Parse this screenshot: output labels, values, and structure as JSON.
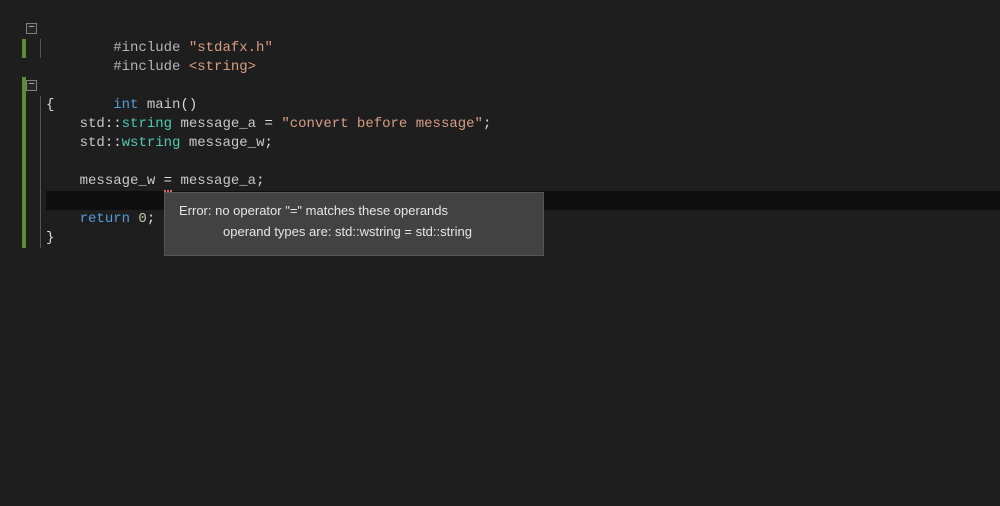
{
  "code": {
    "include_kw": "#include",
    "header1": "\"stdafx.h\"",
    "header2": "<string>",
    "int_kw": "int",
    "main_ident": "main",
    "parens": "()",
    "brace_open": "{",
    "brace_close": "}",
    "std_ns": "std",
    "scope_op": "::",
    "string_t": "string",
    "wstring_t": "wstring",
    "msg_a": "message_a",
    "msg_w": "message_w",
    "eq": " = ",
    "assign_eq": " = ",
    "literal": "\"convert before message\"",
    "semi": ";",
    "return_kw": "return",
    "zero": " 0",
    "indent1": "    ",
    "fold_glyph": "−"
  },
  "tooltip": {
    "line1": "Error: no operator \"=\" matches these operands",
    "line2": "operand types are: std::wstring = std::string"
  }
}
